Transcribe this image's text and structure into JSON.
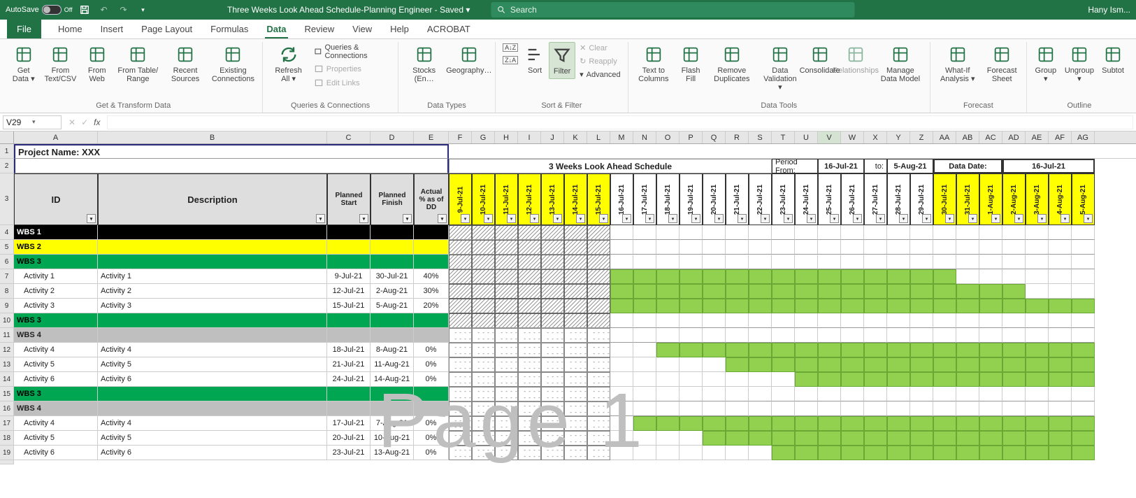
{
  "app": {
    "autosave_label": "AutoSave",
    "autosave_state": "Off",
    "title": "Three Weeks Look Ahead Schedule-Planning Engineer - Saved ▾",
    "search_placeholder": "Search",
    "user": "Hany Ism..."
  },
  "tabs": [
    "File",
    "Home",
    "Insert",
    "Page Layout",
    "Formulas",
    "Data",
    "Review",
    "View",
    "Help",
    "ACROBAT"
  ],
  "active_tab": "Data",
  "ribbon": {
    "get_transform": {
      "label": "Get & Transform Data",
      "buttons": [
        "Get Data ▾",
        "From Text/CSV",
        "From Web",
        "From Table/ Range",
        "Recent Sources",
        "Existing Connections"
      ]
    },
    "queries": {
      "label": "Queries & Connections",
      "refresh": "Refresh All ▾",
      "items": [
        "Queries & Connections",
        "Properties",
        "Edit Links"
      ]
    },
    "data_types": {
      "label": "Data Types",
      "buttons": [
        "Stocks (En…",
        "Geography…"
      ]
    },
    "sort_filter": {
      "label": "Sort & Filter",
      "sort_az": "A→Z",
      "sort_za": "Z→A",
      "sort": "Sort",
      "filter": "Filter",
      "clear": "Clear",
      "reapply": "Reapply",
      "advanced": "Advanced"
    },
    "data_tools": {
      "label": "Data Tools",
      "buttons": [
        "Text to Columns",
        "Flash Fill",
        "Remove Duplicates",
        "Data Validation ▾",
        "Consolidate",
        "Relationships",
        "Manage Data Model"
      ]
    },
    "forecast": {
      "label": "Forecast",
      "buttons": [
        "What-If Analysis ▾",
        "Forecast Sheet"
      ]
    },
    "outline": {
      "label": "Outline",
      "buttons": [
        "Group ▾",
        "Ungroup ▾",
        "Subtot"
      ]
    }
  },
  "namebox": "V29",
  "formula": "",
  "cols": [
    "A",
    "B",
    "C",
    "D",
    "E",
    "F",
    "G",
    "H",
    "I",
    "J",
    "K",
    "L",
    "M",
    "N",
    "O",
    "P",
    "Q",
    "R",
    "S",
    "T",
    "U",
    "V",
    "W",
    "X",
    "Y",
    "Z",
    "AA",
    "AB",
    "AC",
    "AD",
    "AE",
    "AF",
    "AG"
  ],
  "selected_col": "V",
  "sheet": {
    "project": "Project Name: XXX",
    "title3w": "3 Weeks Look Ahead Schedule",
    "period_from_lbl": "Period From:",
    "period_from": "16-Jul-21",
    "to_lbl": "to:",
    "to": "5-Aug-21",
    "data_date_lbl": "Data Date:",
    "data_date": "16-Jul-21",
    "hdr": {
      "id": "ID",
      "desc": "Description",
      "ps": "Planned Start",
      "pf": "Planned Finish",
      "pct": "Actual % as of DD"
    },
    "days": [
      "9-Jul-21",
      "10-Jul-21",
      "11-Jul-21",
      "12-Jul-21",
      "13-Jul-21",
      "14-Jul-21",
      "15-Jul-21",
      "16-Jul-21",
      "17-Jul-21",
      "18-Jul-21",
      "19-Jul-21",
      "20-Jul-21",
      "21-Jul-21",
      "22-Jul-21",
      "23-Jul-21",
      "24-Jul-21",
      "25-Jul-21",
      "26-Jul-21",
      "27-Jul-21",
      "28-Jul-21",
      "29-Jul-21",
      "30-Jul-21",
      "31-Jul-21",
      "1-Aug-21",
      "2-Aug-21",
      "3-Aug-21",
      "4-Aug-21",
      "5-Aug-21"
    ],
    "rows": [
      {
        "n": 4,
        "cls": "wbs1",
        "id": "WBS 1",
        "bar": {
          "from": 0,
          "to": 7,
          "style": "hatch"
        }
      },
      {
        "n": 5,
        "cls": "wbs2",
        "id": "WBS 2",
        "bar": {
          "from": 0,
          "to": 7,
          "style": "hatch"
        }
      },
      {
        "n": 6,
        "cls": "wbs3",
        "id": "WBS 3",
        "bar": {
          "from": 0,
          "to": 7,
          "style": "hatch"
        }
      },
      {
        "n": 7,
        "cls": "",
        "id": "Activity 1",
        "desc": "Activity 1",
        "ps": "9-Jul-21",
        "pf": "30-Jul-21",
        "pct": "40%",
        "bars": [
          {
            "from": 0,
            "to": 7,
            "style": "hatch"
          },
          {
            "from": 7,
            "to": 22,
            "style": "green"
          }
        ]
      },
      {
        "n": 8,
        "cls": "",
        "id": "Activity 2",
        "desc": "Activity 2",
        "ps": "12-Jul-21",
        "pf": "2-Aug-21",
        "pct": "30%",
        "bars": [
          {
            "from": 0,
            "to": 7,
            "style": "hatch"
          },
          {
            "from": 7,
            "to": 25,
            "style": "green"
          }
        ]
      },
      {
        "n": 9,
        "cls": "",
        "id": "Activity 3",
        "desc": "Activity 3",
        "ps": "15-Jul-21",
        "pf": "5-Aug-21",
        "pct": "20%",
        "bars": [
          {
            "from": 0,
            "to": 7,
            "style": "hatch"
          },
          {
            "from": 7,
            "to": 28,
            "style": "green"
          }
        ]
      },
      {
        "n": 10,
        "cls": "wbs3",
        "id": "WBS 3",
        "bar": {
          "from": 0,
          "to": 7,
          "style": "hatch"
        }
      },
      {
        "n": 11,
        "cls": "wbs4",
        "id": "WBS 4",
        "bar": {
          "from": 0,
          "to": 7,
          "style": "dotted"
        }
      },
      {
        "n": 12,
        "cls": "",
        "id": "Activity 4",
        "desc": "Activity 4",
        "ps": "18-Jul-21",
        "pf": "8-Aug-21",
        "pct": "0%",
        "bars": [
          {
            "from": 0,
            "to": 7,
            "style": "dotted"
          },
          {
            "from": 9,
            "to": 28,
            "style": "green"
          }
        ]
      },
      {
        "n": 13,
        "cls": "",
        "id": "Activity 5",
        "desc": "Activity 5",
        "ps": "21-Jul-21",
        "pf": "11-Aug-21",
        "pct": "0%",
        "bars": [
          {
            "from": 0,
            "to": 7,
            "style": "dotted"
          },
          {
            "from": 12,
            "to": 28,
            "style": "green"
          }
        ]
      },
      {
        "n": 14,
        "cls": "",
        "id": "Activity 6",
        "desc": "Activity 6",
        "ps": "24-Jul-21",
        "pf": "14-Aug-21",
        "pct": "0%",
        "bars": [
          {
            "from": 0,
            "to": 7,
            "style": "dotted"
          },
          {
            "from": 15,
            "to": 28,
            "style": "green"
          }
        ]
      },
      {
        "n": 15,
        "cls": "wbs3",
        "id": "WBS 3",
        "bar": {
          "from": 0,
          "to": 7,
          "style": "dotted"
        }
      },
      {
        "n": 16,
        "cls": "wbs4",
        "id": "WBS 4",
        "bar": {
          "from": 0,
          "to": 7,
          "style": "dotted"
        }
      },
      {
        "n": 17,
        "cls": "",
        "id": "Activity 4",
        "desc": "Activity 4",
        "ps": "17-Jul-21",
        "pf": "7-Aug-21",
        "pct": "0%",
        "bars": [
          {
            "from": 0,
            "to": 7,
            "style": "dotted"
          },
          {
            "from": 8,
            "to": 28,
            "style": "green"
          }
        ]
      },
      {
        "n": 18,
        "cls": "",
        "id": "Activity 5",
        "desc": "Activity 5",
        "ps": "20-Jul-21",
        "pf": "10-Aug-21",
        "pct": "0%",
        "bars": [
          {
            "from": 0,
            "to": 7,
            "style": "dotted"
          },
          {
            "from": 11,
            "to": 28,
            "style": "green"
          }
        ]
      },
      {
        "n": 19,
        "cls": "",
        "id": "Activity 6",
        "desc": "Activity 6",
        "ps": "23-Jul-21",
        "pf": "13-Aug-21",
        "pct": "0%",
        "bars": [
          {
            "from": 0,
            "to": 7,
            "style": "dotted"
          },
          {
            "from": 14,
            "to": 28,
            "style": "green"
          }
        ]
      }
    ],
    "watermark": "Page 1"
  }
}
